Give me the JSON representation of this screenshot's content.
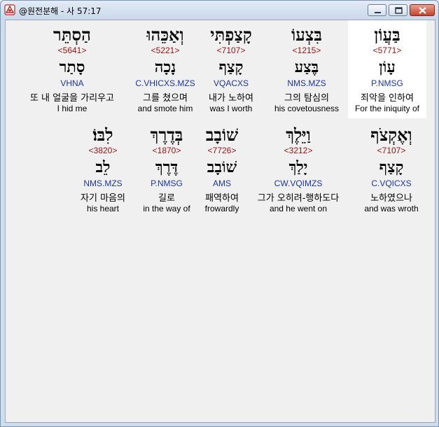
{
  "window": {
    "title": "@원전분해 - 사 57:17",
    "icon": "bible-app-icon",
    "buttons": {
      "minimize": "minimize-icon",
      "maximize": "maximize-icon",
      "close": "close-icon"
    }
  },
  "entries": [
    {
      "hebrew": "בַּעֲוֹן",
      "strong": "<5771>",
      "lemma": "עָוֹן",
      "morph": "P.NMSG",
      "korean": "죄악을 인하여",
      "english": "For the iniquity of",
      "selected": true
    },
    {
      "hebrew": "בִּצְעוֹ",
      "strong": "<1215>",
      "lemma": "בֶּצַע",
      "morph": "NMS.MZS",
      "korean": "그의 탐심의",
      "english": "his covetousness",
      "selected": false
    },
    {
      "hebrew": "קָצַפְתִּי",
      "strong": "<7107>",
      "lemma": "קָצַף",
      "morph": "VQACXS",
      "korean": "내가 노하여",
      "english": "was I worth",
      "selected": false
    },
    {
      "hebrew": "וְאַכֵּהוּ",
      "strong": "<5221>",
      "lemma": "נָכָה",
      "morph": "C.VHICXS.MZS",
      "korean": "그를 쳤으며",
      "english": "and smote him",
      "selected": false
    },
    {
      "hebrew": "הַסְתֵּר",
      "strong": "<5641>",
      "lemma": "סָתַר",
      "morph": "VHNA",
      "korean": "또 내 얼굴을 가리우고",
      "english": "I hid me",
      "selected": false
    },
    {
      "hebrew": "וְאֶקְצֹף",
      "strong": "<7107>",
      "lemma": "קָצַף",
      "morph": "C.VQICXS",
      "korean": "노하였으나",
      "english": "and was wroth",
      "selected": false
    },
    {
      "hebrew": "וַיֵּלֶךְ",
      "strong": "<3212>",
      "lemma": "יָלַךְ",
      "morph": "CW.VQIMZS",
      "korean": "그가 오히려-행하도다",
      "english": "and he went on",
      "selected": false
    },
    {
      "hebrew": "שׁוֹבָב",
      "strong": "<7726>",
      "lemma": "שׁוֹבָב",
      "morph": "AMS",
      "korean": "패역하여",
      "english": "frowardly",
      "selected": false
    },
    {
      "hebrew": "בְּדֶרֶךְ",
      "strong": "<1870>",
      "lemma": "דֶּרֶךְ",
      "morph": "P.NMSG",
      "korean": "길로",
      "english": "in the way of",
      "selected": false
    },
    {
      "hebrew": "לִבּוֹ׃",
      "strong": "<3820>",
      "lemma": "לֵב",
      "morph": "NMS.MZS",
      "korean": "자기 마음의",
      "english": "his heart",
      "selected": false
    }
  ],
  "colors": {
    "strong": "#9b1010",
    "morph": "#1b35a8",
    "selected_bg": "#ffffff"
  }
}
